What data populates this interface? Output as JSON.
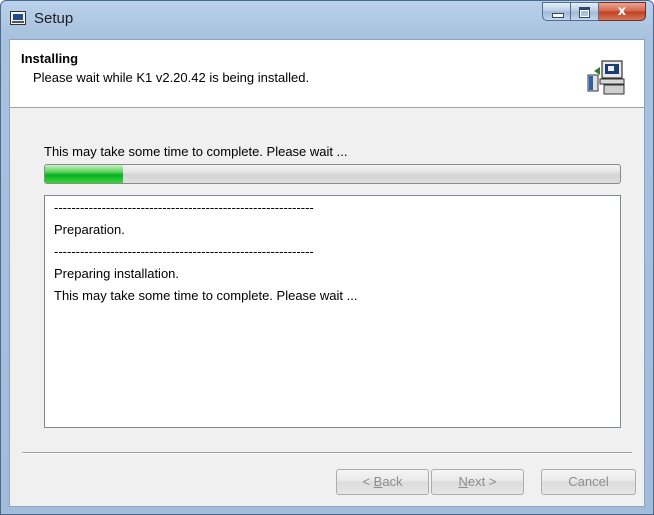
{
  "window": {
    "title": "Setup"
  },
  "header": {
    "title": "Installing",
    "subtitle": "Please wait while K1 v2.20.42 is being installed."
  },
  "status_text": "This may take some time to complete. Please wait ...",
  "progress": {
    "fraction": 0.135
  },
  "log": {
    "lines": [
      "------------------------------------------------------------",
      "Preparation.",
      "------------------------------------------------------------",
      "Preparing installation.",
      "This may take some time to complete. Please wait ..."
    ]
  },
  "buttons": {
    "back": {
      "prefix": "< ",
      "accel": "B",
      "rest": "ack"
    },
    "next": {
      "accel": "N",
      "rest": "ext >"
    },
    "cancel": "Cancel"
  },
  "icons": {
    "app": "installer-computer-icon",
    "title": "setup-window-icon"
  },
  "colors": {
    "progress": "#06b025",
    "close": "#c13b20"
  }
}
